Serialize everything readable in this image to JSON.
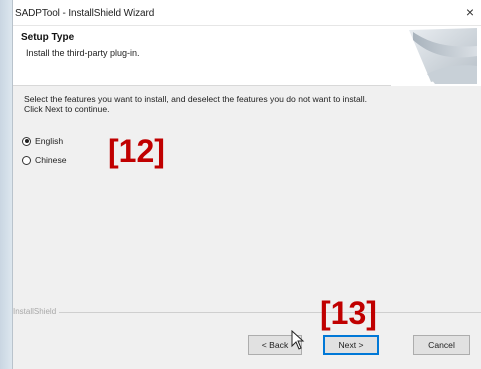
{
  "window": {
    "title": "SADPTool - InstallShield Wizard",
    "close_icon": "close-icon"
  },
  "header": {
    "title": "Setup Type",
    "subtitle": "Install the third-party plug-in."
  },
  "content": {
    "description_line1": "Select the features you want to install, and deselect the features you do not want to install.",
    "description_line2": "Click Next to continue.",
    "options": [
      {
        "label": "English",
        "checked": true
      },
      {
        "label": "Chinese",
        "checked": false
      }
    ]
  },
  "branding": {
    "text": "InstallShield"
  },
  "footer": {
    "back_label": "< Back",
    "next_label": "Next >",
    "cancel_label": "Cancel"
  },
  "annotations": {
    "label_12": "[12]",
    "label_13": "[13]"
  },
  "colors": {
    "annotation": "#c00000",
    "primary_border": "#0078d7",
    "panel_bg": "#f0f0f0"
  }
}
